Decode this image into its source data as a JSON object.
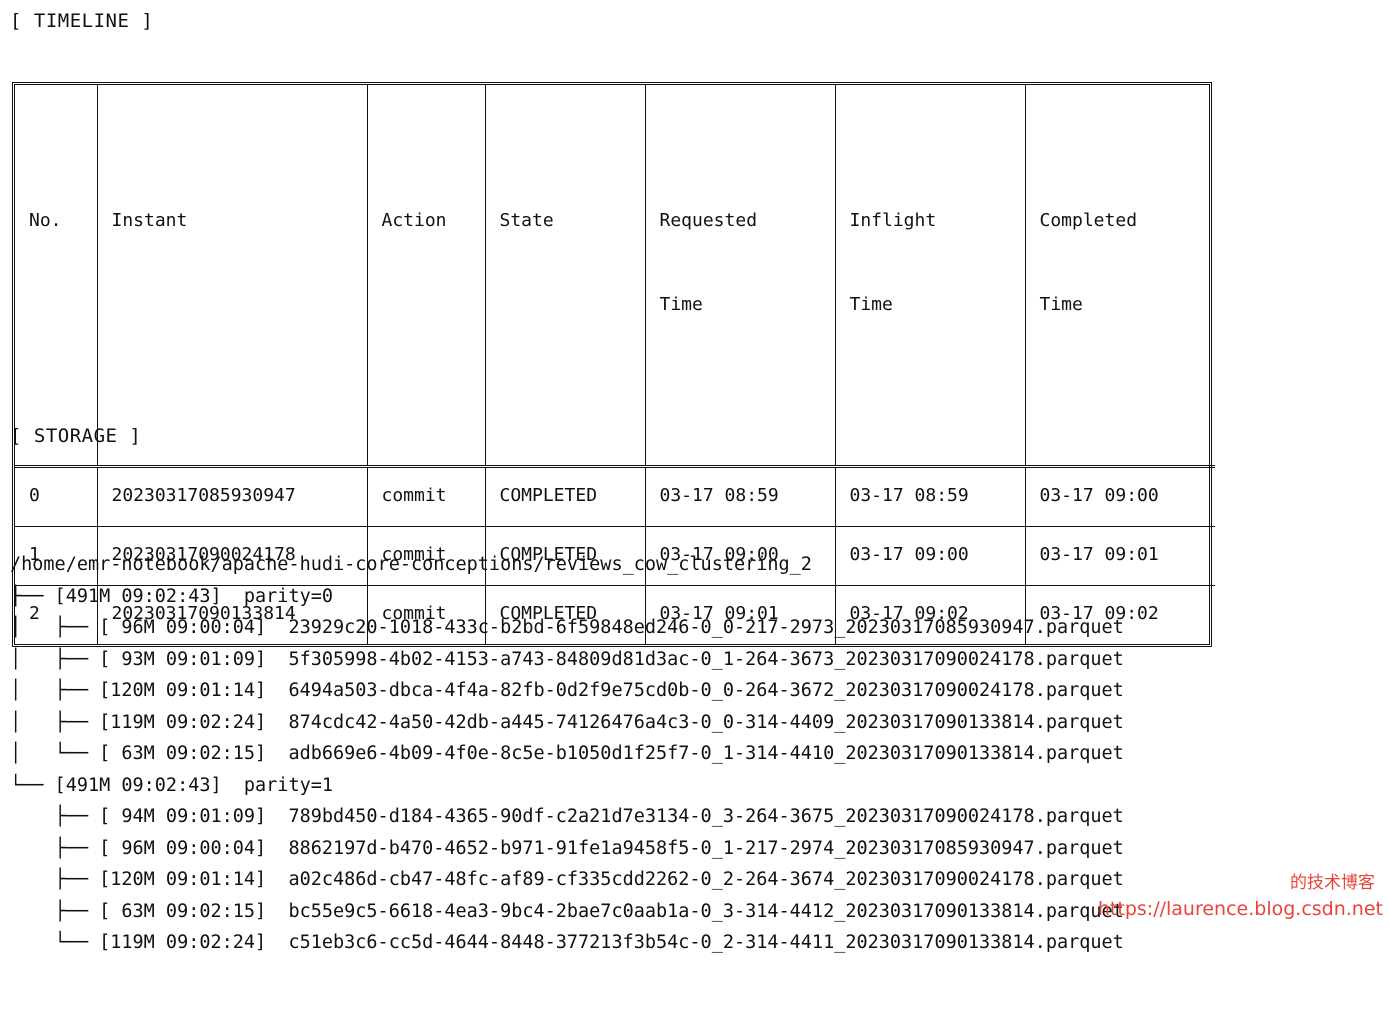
{
  "sections": {
    "timeline_label": "[ TIMELINE ]",
    "storage_label": "[ STORAGE ]"
  },
  "timeline": {
    "columns": [
      {
        "key": "no",
        "label": "No.",
        "label_line2": ""
      },
      {
        "key": "instant",
        "label": "Instant",
        "label_line2": ""
      },
      {
        "key": "action",
        "label": "Action",
        "label_line2": ""
      },
      {
        "key": "state",
        "label": "State",
        "label_line2": ""
      },
      {
        "key": "requested",
        "label": "Requested",
        "label_line2": "Time"
      },
      {
        "key": "inflight",
        "label": "Inflight",
        "label_line2": "Time"
      },
      {
        "key": "completed",
        "label": "Completed",
        "label_line2": "Time"
      }
    ],
    "rows": [
      {
        "no": "0",
        "instant": "20230317085930947",
        "action": "commit",
        "state": "COMPLETED",
        "requested": "03-17 08:59",
        "inflight": "03-17 08:59",
        "completed": "03-17 09:00"
      },
      {
        "no": "1",
        "instant": "20230317090024178",
        "action": "commit",
        "state": "COMPLETED",
        "requested": "03-17 09:00",
        "inflight": "03-17 09:00",
        "completed": "03-17 09:01"
      },
      {
        "no": "2",
        "instant": "20230317090133814",
        "action": "commit",
        "state": "COMPLETED",
        "requested": "03-17 09:01",
        "inflight": "03-17 09:02",
        "completed": "03-17 09:02"
      }
    ]
  },
  "storage": {
    "root_path": "/home/emr-notebook/apache-hudi-core-conceptions/reviews_cow_clustering_2",
    "tree_text": "├── [491M 09:02:43]  parity=0\n│   ├── [ 96M 09:00:04]  23929c20-1018-433c-b2bd-6f59848ed246-0_0-217-2973_20230317085930947.parquet\n│   ├── [ 93M 09:01:09]  5f305998-4b02-4153-a743-84809d81d3ac-0_1-264-3673_20230317090024178.parquet\n│   ├── [120M 09:01:14]  6494a503-dbca-4f4a-82fb-0d2f9e75cd0b-0_0-264-3672_20230317090024178.parquet\n│   ├── [119M 09:02:24]  874cdc42-4a50-42db-a445-74126476a4c3-0_0-314-4409_20230317090133814.parquet\n│   └── [ 63M 09:02:15]  adb669e6-4b09-4f0e-8c5e-b1050d1f25f7-0_1-314-4410_20230317090133814.parquet\n└── [491M 09:02:43]  parity=1\n    ├── [ 94M 09:01:09]  789bd450-d184-4365-90df-c2a21d7e3134-0_3-264-3675_20230317090024178.parquet\n    ├── [ 96M 09:00:04]  8862197d-b470-4652-b971-91fe1a9458f5-0_1-217-2974_20230317085930947.parquet\n    ├── [120M 09:01:14]  a02c486d-cb47-48fc-af89-cf335cdd2262-0_2-264-3674_20230317090024178.parquet\n    ├── [ 63M 09:02:15]  bc55e9c5-6618-4ea3-9bc4-2bae7c0aab1a-0_3-314-4412_20230317090133814.parquet\n    └── [119M 09:02:24]  c51eb3c6-cc5d-4644-8448-377213f3b54c-0_2-314-4411_20230317090133814.parquet",
    "entries": [
      {
        "depth": 0,
        "connector": "├──",
        "size": "491M",
        "time": "09:02:43",
        "name": "parity=0"
      },
      {
        "depth": 1,
        "connector": "├──",
        "size": " 96M",
        "time": "09:00:04",
        "name": "23929c20-1018-433c-b2bd-6f59848ed246-0_0-217-2973_20230317085930947.parquet"
      },
      {
        "depth": 1,
        "connector": "├──",
        "size": " 93M",
        "time": "09:01:09",
        "name": "5f305998-4b02-4153-a743-84809d81d3ac-0_1-264-3673_20230317090024178.parquet"
      },
      {
        "depth": 1,
        "connector": "├──",
        "size": "120M",
        "time": "09:01:14",
        "name": "6494a503-dbca-4f4a-82fb-0d2f9e75cd0b-0_0-264-3672_20230317090024178.parquet"
      },
      {
        "depth": 1,
        "connector": "├──",
        "size": "119M",
        "time": "09:02:24",
        "name": "874cdc42-4a50-42db-a445-74126476a4c3-0_0-314-4409_20230317090133814.parquet"
      },
      {
        "depth": 1,
        "connector": "└──",
        "size": " 63M",
        "time": "09:02:15",
        "name": "adb669e6-4b09-4f0e-8c5e-b1050d1f25f7-0_1-314-4410_20230317090133814.parquet"
      },
      {
        "depth": 0,
        "connector": "└──",
        "size": "491M",
        "time": "09:02:43",
        "name": "parity=1"
      },
      {
        "depth": 1,
        "connector": "├──",
        "size": " 94M",
        "time": "09:01:09",
        "name": "789bd450-d184-4365-90df-c2a21d7e3134-0_3-264-3675_20230317090024178.parquet"
      },
      {
        "depth": 1,
        "connector": "├──",
        "size": " 96M",
        "time": "09:00:04",
        "name": "8862197d-b470-4652-b971-91fe1a9458f5-0_1-217-2974_20230317085930947.parquet"
      },
      {
        "depth": 1,
        "connector": "├──",
        "size": "120M",
        "time": "09:01:14",
        "name": "a02c486d-cb47-48fc-af89-cf335cdd2262-0_2-264-3674_20230317090024178.parquet"
      },
      {
        "depth": 1,
        "connector": "├──",
        "size": " 63M",
        "time": "09:02:15",
        "name": "bc55e9c5-6618-4ea3-9bc4-2bae7c0aab1a-0_3-314-4412_20230317090133814.parquet"
      },
      {
        "depth": 1,
        "connector": "└──",
        "size": "119M",
        "time": "09:02:24",
        "name": "c51eb3c6-cc5d-4644-8448-377213f3b54c-0_2-314-4411_20230317090133814.parquet"
      }
    ]
  },
  "watermark": {
    "cn_text": "的技术博客",
    "url": "https://laurence.blog.csdn.net",
    "color": "#e8443a"
  }
}
